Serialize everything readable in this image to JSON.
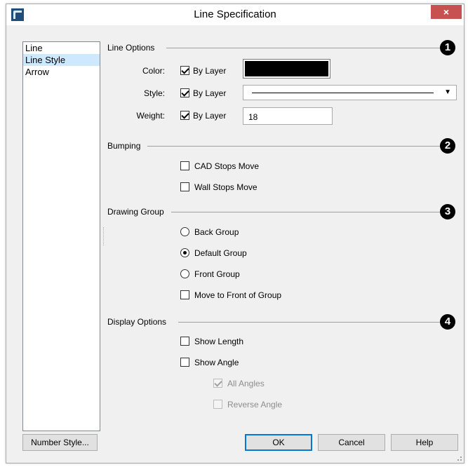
{
  "window": {
    "title": "Line Specification",
    "close_glyph": "×"
  },
  "sidebar": {
    "items": [
      "Line",
      "Line Style",
      "Arrow"
    ],
    "selected": "Line Style"
  },
  "sections": {
    "line_options": {
      "label": "Line Options",
      "callout": "1"
    },
    "bumping": {
      "label": "Bumping",
      "callout": "2"
    },
    "drawing_group": {
      "label": "Drawing Group",
      "callout": "3"
    },
    "display_options": {
      "label": "Display Options",
      "callout": "4"
    }
  },
  "line_options": {
    "color_label": "Color:",
    "style_label": "Style:",
    "weight_label": "Weight:",
    "by_layer_label": "By Layer",
    "color_by_layer": true,
    "style_by_layer": true,
    "weight_by_layer": true,
    "color_value": "#000000",
    "weight_value": "18"
  },
  "bumping": {
    "cad_stops_move": "CAD Stops Move",
    "wall_stops_move": "Wall Stops Move"
  },
  "drawing_group": {
    "back_group": "Back Group",
    "default_group": "Default Group",
    "front_group": "Front Group",
    "move_to_front": "Move to Front of Group",
    "selected": "Default Group"
  },
  "display_options": {
    "show_length": "Show Length",
    "show_angle": "Show Angle",
    "all_angles": "All Angles",
    "reverse_angle": "Reverse Angle"
  },
  "buttons": {
    "number_style": "Number Style...",
    "ok": "OK",
    "cancel": "Cancel",
    "help": "Help"
  },
  "colors": {
    "selection": "#cde8ff",
    "close": "#c75050",
    "accent": "#0078d7"
  }
}
